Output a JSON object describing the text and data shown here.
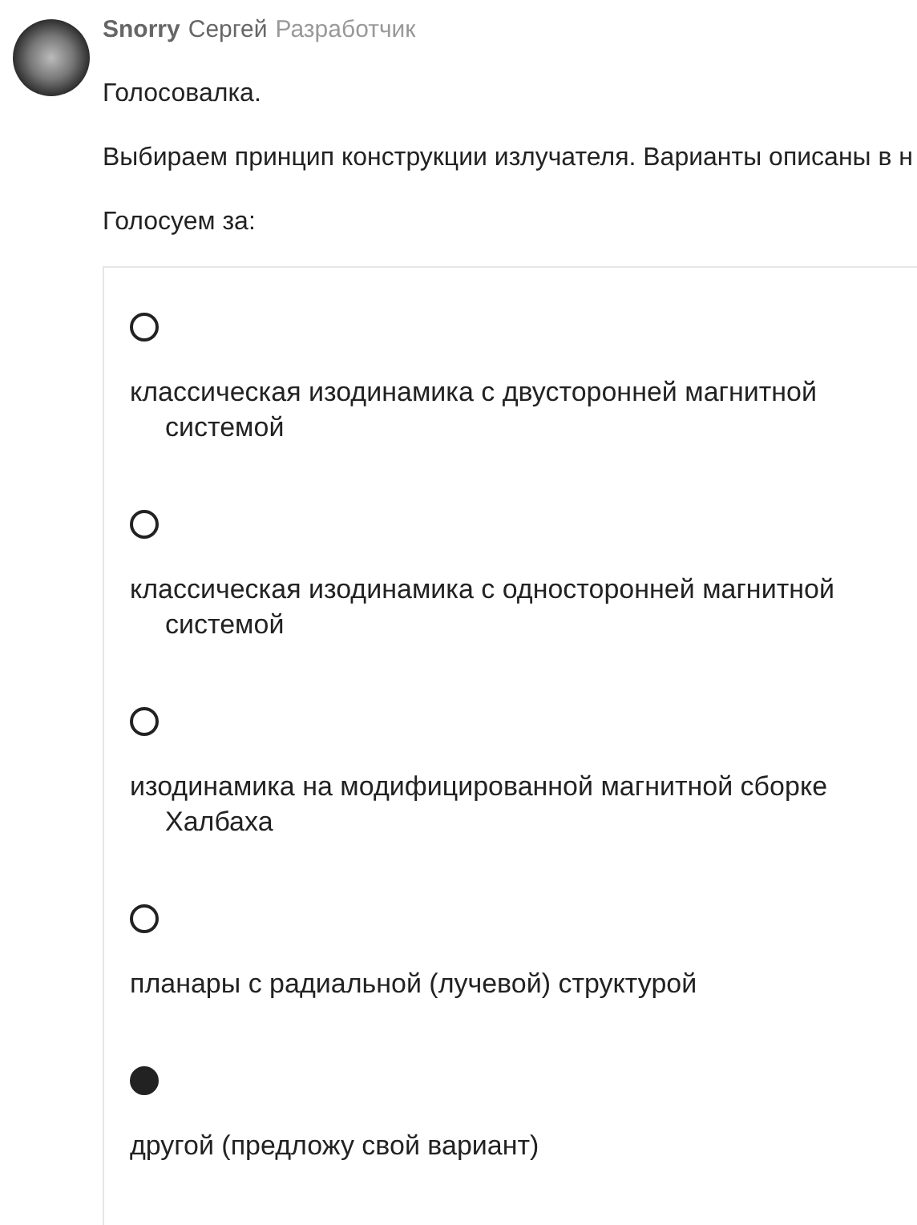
{
  "author": {
    "nickname": "Snorry",
    "name": "Сергей",
    "role": "Разработчик"
  },
  "paragraphs": [
    "Голосовалка.",
    "Выбираем принцип конструкции излучателя. Варианты описаны в н",
    "Голосуем за:"
  ],
  "poll": {
    "options": [
      {
        "label": "классическая изодинамика с двусторонней магнитной системой",
        "selected": false
      },
      {
        "label": "классическая изодинамика с односторонней магнитной системой",
        "selected": false
      },
      {
        "label": "изодинамика на модифицированной магнитной сборке Халбаха",
        "selected": false
      },
      {
        "label": "планары с радиальной (лучевой) структурой",
        "selected": false
      },
      {
        "label": "другой (предложу свой вариант)",
        "selected": true
      }
    ]
  }
}
